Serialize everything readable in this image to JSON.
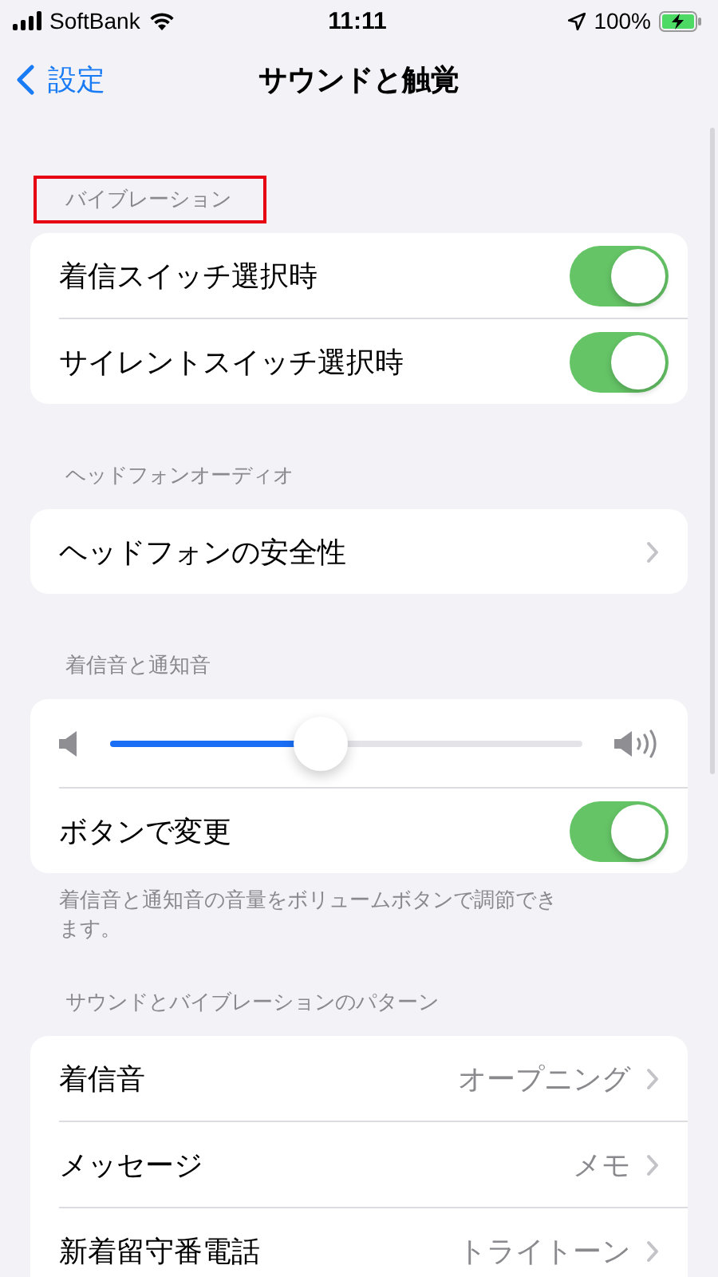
{
  "status_bar": {
    "carrier": "SoftBank",
    "time": "11:11",
    "battery": "100%"
  },
  "nav": {
    "back": "設定",
    "title": "サウンドと触覚"
  },
  "sections": [
    {
      "header": "バイブレーション",
      "highlighted": true,
      "items": [
        {
          "kind": "toggle",
          "label": "着信スイッチ選択時",
          "on": true
        },
        {
          "kind": "toggle",
          "label": "サイレントスイッチ選択時",
          "on": true
        }
      ]
    },
    {
      "header": "ヘッドフォンオーディオ",
      "highlighted": false,
      "items": [
        {
          "kind": "link",
          "label": "ヘッドフォンの安全性"
        }
      ]
    },
    {
      "header": "着信音と通知音",
      "highlighted": false,
      "footer": "着信音と通知音の音量をボリュームボタンで調節できます。",
      "items": [
        {
          "kind": "slider",
          "level": 0.4
        },
        {
          "kind": "toggle",
          "label": "ボタンで変更",
          "on": true
        }
      ]
    },
    {
      "header": "サウンドとバイブレーションのパターン",
      "highlighted": false,
      "items": [
        {
          "kind": "link",
          "label": "着信音",
          "value": "オープニング"
        },
        {
          "kind": "link",
          "label": "メッセージ",
          "value": "メモ"
        },
        {
          "kind": "link",
          "label": "新着留守番電話",
          "value": "トライトーン"
        }
      ]
    }
  ]
}
